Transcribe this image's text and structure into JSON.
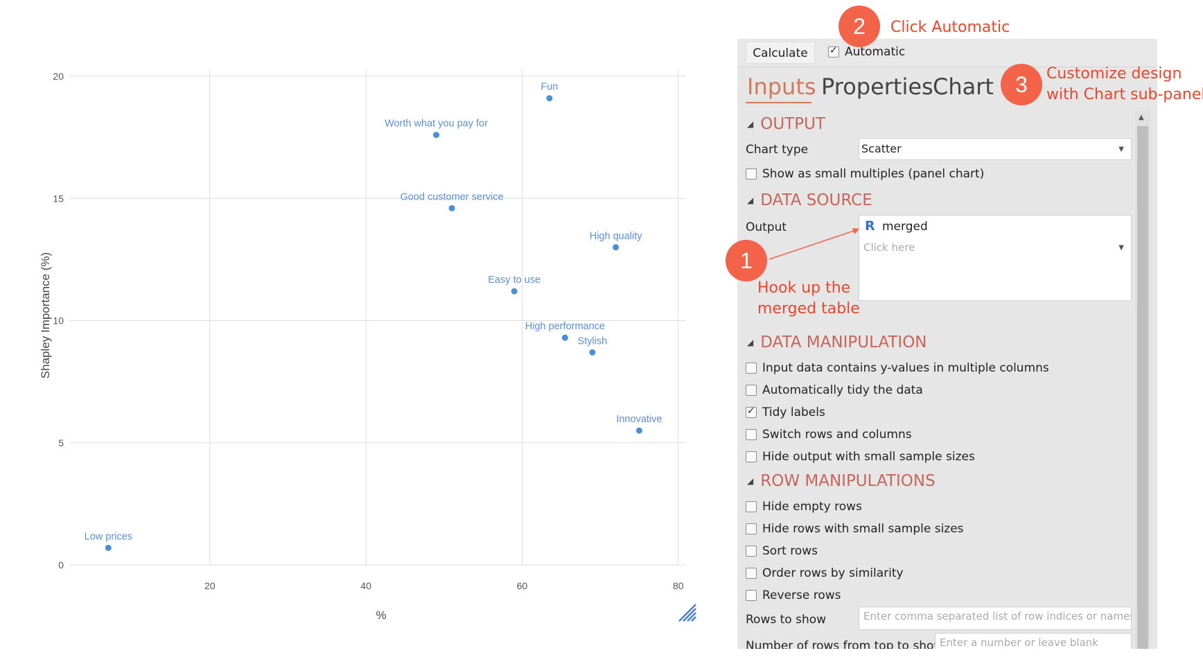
{
  "colors": {
    "accent": "#d07a5a",
    "section": "#c8655a",
    "badge": "#f2634a",
    "note": "#e8472c",
    "point": "#4a90d9",
    "point_label": "#5b8fd6"
  },
  "chart_data": {
    "type": "scatter",
    "xlabel": "%",
    "ylabel": "Shapley Importance (%)",
    "xlim": [
      2,
      81
    ],
    "ylim": [
      0,
      20
    ],
    "xticks": [
      20,
      40,
      60,
      80
    ],
    "yticks": [
      0,
      5,
      10,
      15,
      20
    ],
    "grid": true,
    "points": [
      {
        "label": "Fun",
        "x": 63.5,
        "y": 19.1
      },
      {
        "label": "Worth what you pay for",
        "x": 49,
        "y": 17.6
      },
      {
        "label": "Good customer service",
        "x": 51,
        "y": 14.6
      },
      {
        "label": "High quality",
        "x": 72,
        "y": 13.0
      },
      {
        "label": "Easy to use",
        "x": 59,
        "y": 11.2
      },
      {
        "label": "High performance",
        "x": 65.5,
        "y": 9.3
      },
      {
        "label": "Stylish",
        "x": 69,
        "y": 8.7
      },
      {
        "label": "Innovative",
        "x": 75,
        "y": 5.5
      },
      {
        "label": "Low prices",
        "x": 7,
        "y": 0.7
      }
    ]
  },
  "toolbar": {
    "calculate": "Calculate",
    "automatic": "Automatic"
  },
  "tabs": [
    "Inputs",
    "Properties",
    "Chart"
  ],
  "sections": {
    "output": "OUTPUT",
    "data_source": "DATA SOURCE",
    "data_manipulation": "DATA MANIPULATION",
    "row_manipulation": "ROW MANIPULATIONS"
  },
  "output": {
    "chart_type_label": "Chart type",
    "chart_type_value": "Scatter",
    "small_multiples": "Show as small multiples (panel chart)"
  },
  "data_source": {
    "output_label": "Output",
    "r_icon": "R",
    "selected": "merged",
    "placeholder": "Click here"
  },
  "data_manipulation": [
    {
      "label": "Input data contains y-values in multiple columns",
      "checked": false
    },
    {
      "label": "Automatically tidy the data",
      "checked": false
    },
    {
      "label": "Tidy labels",
      "checked": true
    },
    {
      "label": "Switch rows and columns",
      "checked": false
    },
    {
      "label": "Hide output with small sample sizes",
      "checked": false
    }
  ],
  "row_manipulation": [
    {
      "label": "Hide empty rows",
      "checked": false
    },
    {
      "label": "Hide rows with small sample sizes",
      "checked": false
    },
    {
      "label": "Sort rows",
      "checked": false
    },
    {
      "label": "Order rows by similarity",
      "checked": false
    },
    {
      "label": "Reverse rows",
      "checked": false
    }
  ],
  "rows_to_show": {
    "label": "Rows to show",
    "placeholder": "Enter comma separated list of row indices or names"
  },
  "rows_from_top": {
    "label": "Number of rows from top to show",
    "placeholder": "Enter a number or leave blank"
  },
  "annotations": [
    {
      "number": "1",
      "text": "Hook up the\nmerged table"
    },
    {
      "number": "2",
      "text": "Click Automatic"
    },
    {
      "number": "3",
      "text": "Customize design\nwith Chart sub-panel"
    }
  ]
}
